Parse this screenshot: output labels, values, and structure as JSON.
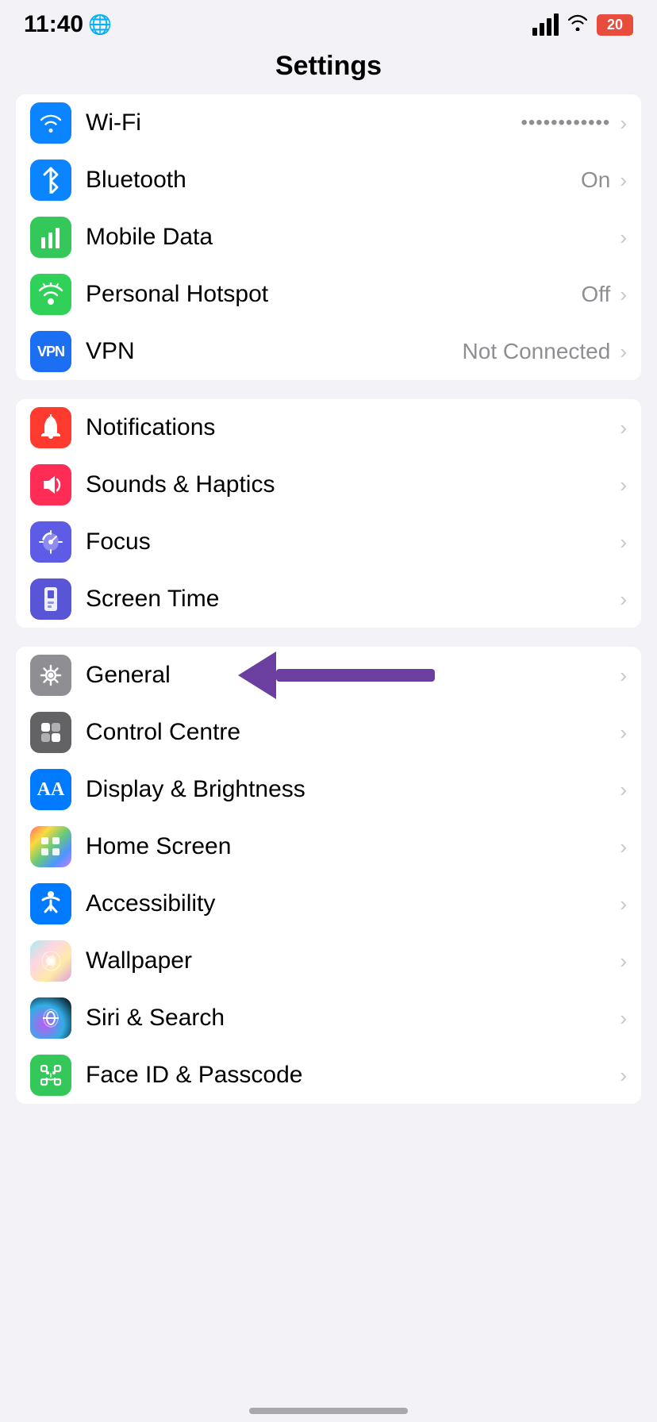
{
  "statusBar": {
    "time": "11:40",
    "batteryText": "20",
    "batteryColor": "#e74c3c"
  },
  "header": {
    "title": "Settings"
  },
  "groups": [
    {
      "id": "network",
      "rows": [
        {
          "id": "wifi-partial",
          "label": "Wi-Fi",
          "value": "",
          "iconBg": "bg-blue",
          "iconType": "wifi",
          "partial": true
        },
        {
          "id": "bluetooth",
          "label": "Bluetooth",
          "value": "On",
          "iconBg": "bg-blue",
          "iconType": "bluetooth"
        },
        {
          "id": "mobile-data",
          "label": "Mobile Data",
          "value": "",
          "iconBg": "bg-green",
          "iconType": "signal"
        },
        {
          "id": "personal-hotspot",
          "label": "Personal Hotspot",
          "value": "Off",
          "iconBg": "bg-green2",
          "iconType": "hotspot"
        },
        {
          "id": "vpn",
          "label": "VPN",
          "value": "Not Connected",
          "iconBg": "bg-vpn",
          "iconType": "vpn"
        }
      ]
    },
    {
      "id": "notifications",
      "rows": [
        {
          "id": "notifications",
          "label": "Notifications",
          "value": "",
          "iconBg": "bg-red",
          "iconType": "notifications"
        },
        {
          "id": "sounds-haptics",
          "label": "Sounds & Haptics",
          "value": "",
          "iconBg": "bg-pink",
          "iconType": "sound"
        },
        {
          "id": "focus",
          "label": "Focus",
          "value": "",
          "iconBg": "bg-purple",
          "iconType": "moon"
        },
        {
          "id": "screen-time",
          "label": "Screen Time",
          "value": "",
          "iconBg": "bg-indigo",
          "iconType": "hourglass"
        }
      ]
    },
    {
      "id": "general",
      "rows": [
        {
          "id": "general",
          "label": "General",
          "value": "",
          "iconBg": "bg-gray",
          "iconType": "gear",
          "hasArrow": true
        },
        {
          "id": "control-centre",
          "label": "Control Centre",
          "value": "",
          "iconBg": "bg-gray2",
          "iconType": "toggles"
        },
        {
          "id": "display-brightness",
          "label": "Display & Brightness",
          "value": "",
          "iconBg": "bg-blue2",
          "iconType": "aa"
        },
        {
          "id": "home-screen",
          "label": "Home Screen",
          "value": "",
          "iconBg": "bg-multicolor",
          "iconType": "grid"
        },
        {
          "id": "accessibility",
          "label": "Accessibility",
          "value": "",
          "iconBg": "bg-blue2",
          "iconType": "accessibility"
        },
        {
          "id": "wallpaper",
          "label": "Wallpaper",
          "value": "",
          "iconBg": "bg-multicolor",
          "iconType": "flower"
        },
        {
          "id": "siri-search",
          "label": "Siri & Search",
          "value": "",
          "iconBg": "bg-siri",
          "iconType": "siri"
        },
        {
          "id": "face-id",
          "label": "Face ID & Passcode",
          "value": "",
          "iconBg": "bg-faceid",
          "iconType": "faceid"
        }
      ]
    }
  ],
  "labels": {
    "on": "On",
    "off": "Off",
    "notConnected": "Not Connected"
  }
}
